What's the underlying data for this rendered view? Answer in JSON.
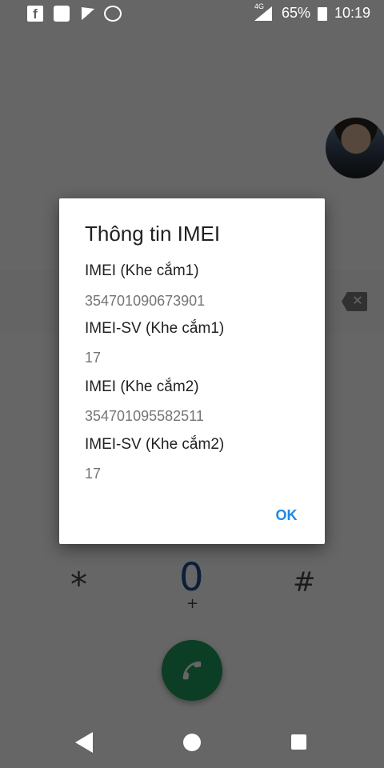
{
  "status_bar": {
    "network": "4G",
    "battery_percent": "65%",
    "time": "10:19",
    "icons": [
      "facebook-icon",
      "maps-icon",
      "check-icon",
      "messenger-icon",
      "signal-icon",
      "battery-icon"
    ]
  },
  "dialer": {
    "keys": {
      "star": "*",
      "zero": "0",
      "plus": "+",
      "hash": "#"
    }
  },
  "dialog": {
    "title": "Thông tin IMEI",
    "items": [
      {
        "label": "IMEI (Khe cắm1)",
        "value": "354701090673901"
      },
      {
        "label": "IMEI-SV (Khe cắm1)",
        "value": "17"
      },
      {
        "label": "IMEI (Khe cắm2)",
        "value": "354701095582511"
      },
      {
        "label": "IMEI-SV (Khe cắm2)",
        "value": "17"
      }
    ],
    "ok_label": "OK",
    "ok_color": "#1e88e5"
  },
  "colors": {
    "call_button": "#1e9a5c",
    "zero_key": "#1f4e8c"
  }
}
